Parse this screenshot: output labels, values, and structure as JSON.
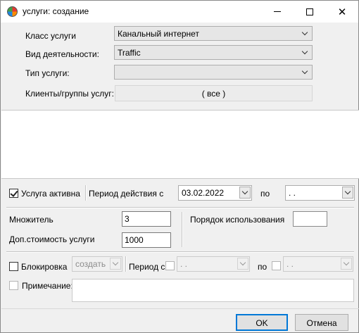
{
  "window": {
    "title": "услуги: создание"
  },
  "form": {
    "service_class": {
      "label": "Класс услуги",
      "value": "Канальный интернет"
    },
    "activity_type": {
      "label": "Вид деятельности:",
      "value": "Traffic"
    },
    "service_type": {
      "label": "Тип услуги:",
      "value": ""
    },
    "clients": {
      "label": "Клиенты/группы услуг:",
      "value": "( все )"
    }
  },
  "period_row": {
    "active_checkbox": {
      "label": "Услуга активна",
      "checked": true
    },
    "period_label": "Период действия с",
    "date_from": "03.02.2022",
    "to_label": "по",
    "date_to": " .  ."
  },
  "mid": {
    "multiplier": {
      "label": "Множитель",
      "value": "3"
    },
    "extra_cost": {
      "label": "Доп.стоимость услуги",
      "value": "1000"
    },
    "usage_order": {
      "label": "Порядок использования",
      "value": ""
    }
  },
  "block_row": {
    "block_checkbox": {
      "label": "Блокировка",
      "checked": false
    },
    "action_select": "создать",
    "period_label": "Период с",
    "date_from": " .  .",
    "to_label": "по",
    "date_to": " .  ."
  },
  "note": {
    "label": "Примечание:",
    "checked": false,
    "value": ""
  },
  "buttons": {
    "ok": "OK",
    "cancel": "Отмена"
  }
}
